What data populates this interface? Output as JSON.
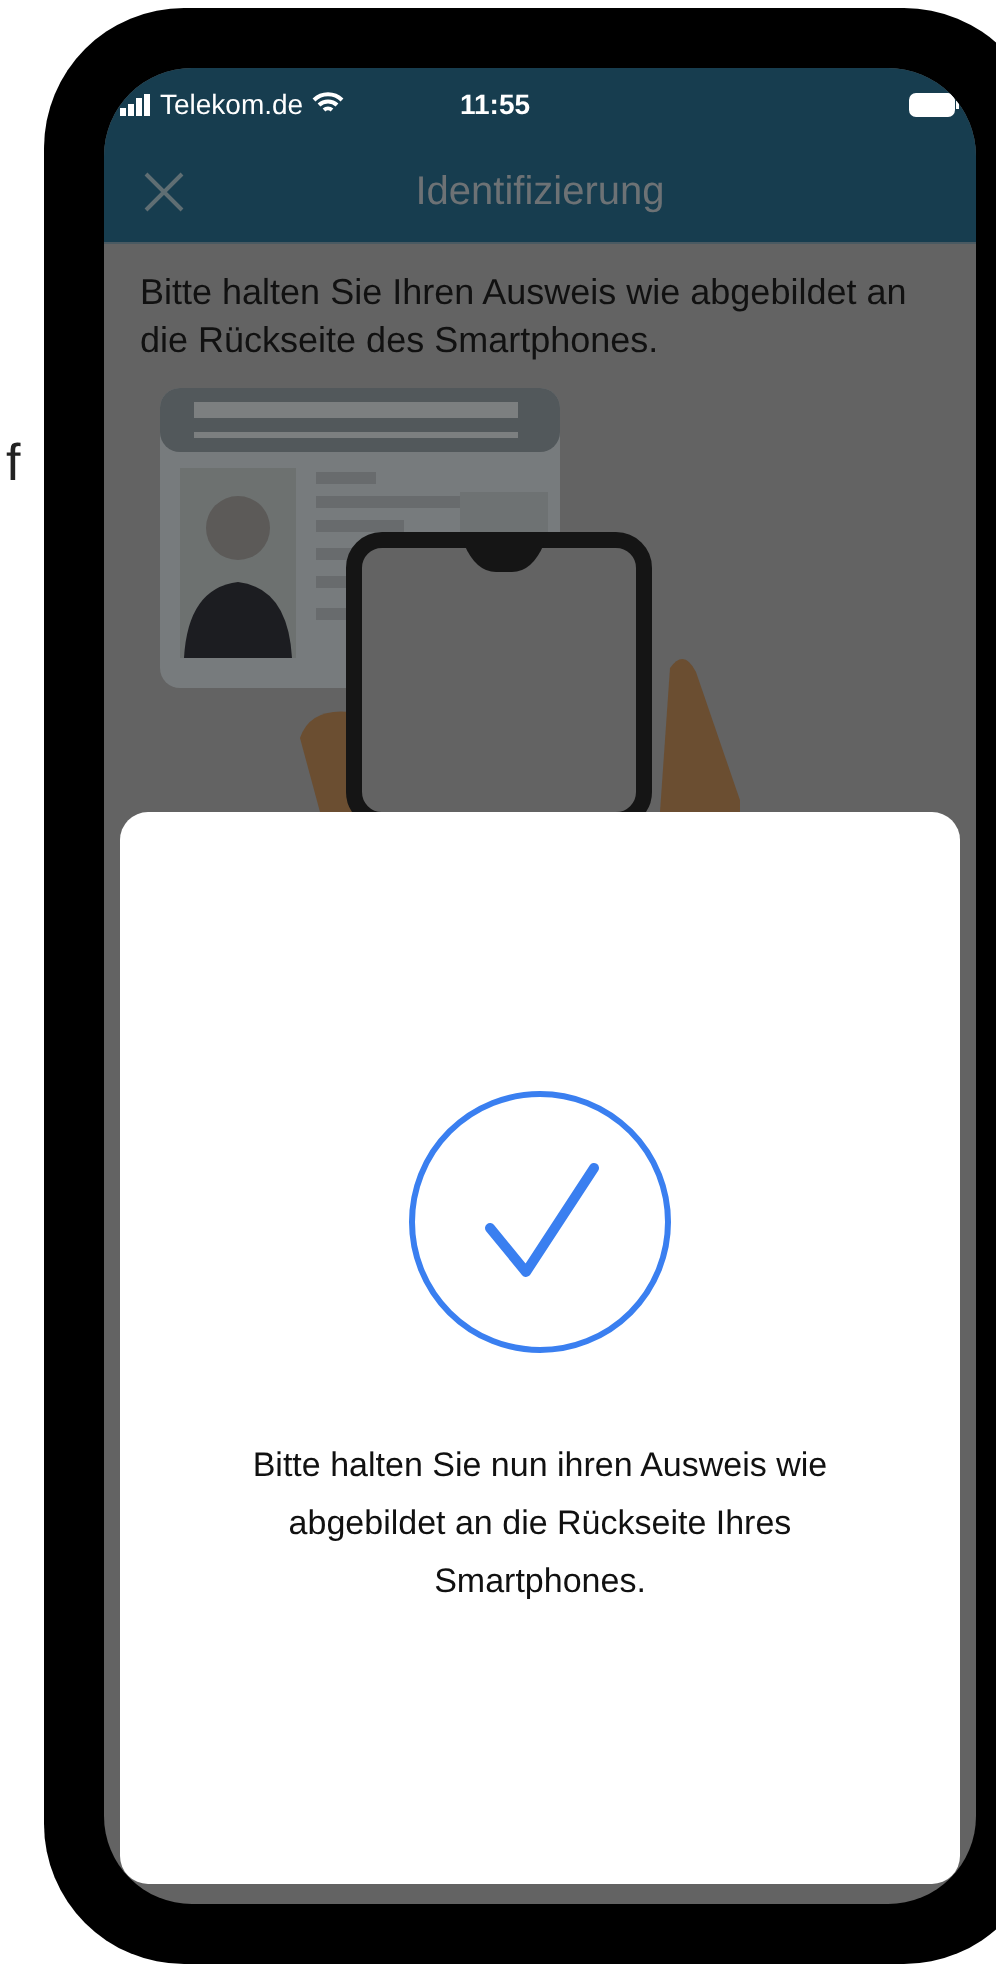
{
  "background_fragment": "f",
  "status_bar": {
    "carrier": "Telekom.de",
    "time": "11:55"
  },
  "header": {
    "title": "Identifizierung"
  },
  "instruction": "Bitte halten Sie Ihren Ausweis wie abgebildet an die Rückseite des Smartphones.",
  "dialog": {
    "message": "Bitte halten Sie nun ihren Ausweis wie abgebildet an die Rückseite Ihres Smartphones."
  }
}
